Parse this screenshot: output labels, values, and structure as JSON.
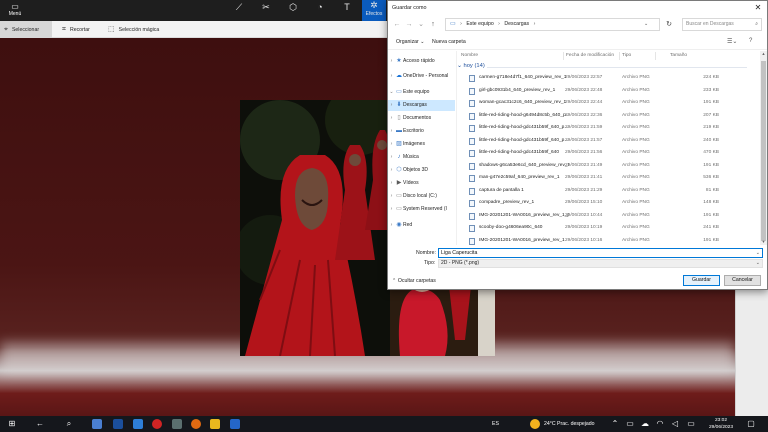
{
  "paint": {
    "menu_label": "Menú",
    "tools": [
      {
        "icon": "brush-icon",
        "glyph": "⟋"
      },
      {
        "icon": "shapes-2d-icon",
        "glyph": "✂"
      },
      {
        "icon": "shapes-3d-icon",
        "glyph": "⬡"
      },
      {
        "icon": "stickers-icon",
        "glyph": "◔"
      },
      {
        "icon": "text-icon",
        "glyph": "T"
      },
      {
        "icon": "effects-icon",
        "glyph": "✲",
        "label": "Efectos",
        "active": true
      }
    ],
    "subtools": {
      "select": "Seleccionar",
      "crop": "Recortar",
      "magic_select": "Selección mágica"
    }
  },
  "dialog": {
    "title": "Guardar como",
    "path": [
      "Este equipo",
      "Descargas"
    ],
    "search_placeholder": "Buscar en Descargas",
    "organize": "Organizar",
    "new_folder": "Nueva carpeta",
    "tree": [
      {
        "label": "Acceso rápido",
        "icon": "star-icon",
        "glyph": "★",
        "color": "#3a79c6",
        "chev": "›"
      },
      {
        "label": "OneDrive - Personal",
        "icon": "cloud-icon",
        "glyph": "☁",
        "color": "#1b74d6",
        "chev": "›"
      },
      {
        "label": "Este equipo",
        "icon": "computer-icon",
        "glyph": "▭",
        "color": "#3a79c6",
        "chev": "⌄"
      },
      {
        "label": "Descargas",
        "icon": "download-icon",
        "glyph": "⬇",
        "color": "#2f6fc0",
        "chev": "›",
        "selected": true
      },
      {
        "label": "Documentos",
        "icon": "document-icon",
        "glyph": "▯",
        "color": "#8a8a8a",
        "chev": "›"
      },
      {
        "label": "Escritorio",
        "icon": "desktop-icon",
        "glyph": "▬",
        "color": "#3a79c6",
        "chev": "›"
      },
      {
        "label": "Imágenes",
        "icon": "pictures-icon",
        "glyph": "▨",
        "color": "#3a79c6",
        "chev": "›"
      },
      {
        "label": "Música",
        "icon": "music-icon",
        "glyph": "♪",
        "color": "#3a79c6",
        "chev": "›"
      },
      {
        "label": "Objetos 3D",
        "icon": "cube-icon",
        "glyph": "⬡",
        "color": "#3a79c6",
        "chev": "›"
      },
      {
        "label": "Vídeos",
        "icon": "video-icon",
        "glyph": "▶",
        "color": "#5a5a5a",
        "chev": "›"
      },
      {
        "label": "Disco local (C:)",
        "icon": "drive-icon",
        "glyph": "▭",
        "color": "#7a7a7a",
        "chev": "›"
      },
      {
        "label": "System Reserved (I",
        "icon": "drive-icon",
        "glyph": "▭",
        "color": "#7a7a7a",
        "chev": "›"
      },
      {
        "label": "Red",
        "icon": "network-icon",
        "glyph": "◉",
        "color": "#3a79c6",
        "chev": "›"
      }
    ],
    "columns": {
      "name": "Nombre",
      "date": "Fecha de modificación",
      "type": "Tipo",
      "size": "Tamaño"
    },
    "group_label": "hoy (14)",
    "files": [
      {
        "name": "carmen-g718e4d7f1_640_preview_rev_1",
        "date": "29/06/2023 22:57",
        "type": "Archivo PNG",
        "size": "224 KB"
      },
      {
        "name": "girl-gbc0931b4_640_preview_rev_1",
        "date": "29/06/2023 22:48",
        "type": "Archivo PNG",
        "size": "233 KB"
      },
      {
        "name": "woman-gcac31c2c6_640_preview_rev_1",
        "date": "29/06/2023 22:44",
        "type": "Archivo PNG",
        "size": "191 KB"
      },
      {
        "name": "little-red-riding-hood-g6494d8c5b_640_p...",
        "date": "29/06/2023 22:36",
        "type": "Archivo PNG",
        "size": "207 KB"
      },
      {
        "name": "little-red-riding-hood-gdc431b59f_640_p...",
        "date": "29/06/2023 21:59",
        "type": "Archivo PNG",
        "size": "219 KB"
      },
      {
        "name": "little-red-riding-hood-gdc431b59f_640_p...",
        "date": "29/06/2023 21:57",
        "type": "Archivo PNG",
        "size": "240 KB"
      },
      {
        "name": "little-red-riding-hood-gdc431b59f_640",
        "date": "29/06/2023 21:56",
        "type": "Archivo PNG",
        "size": "470 KB"
      },
      {
        "name": "shadows-g6ca53e6cd_640_preview_rev_1",
        "date": "29/06/2023 21:49",
        "type": "Archivo PNG",
        "size": "191 KB"
      },
      {
        "name": "man-g47e2c59af_640_preview_rev_1",
        "date": "29/06/2023 21:41",
        "type": "Archivo PNG",
        "size": "536 KB"
      },
      {
        "name": "captura de pantalla 1",
        "date": "29/06/2023 21:29",
        "type": "Archivo PNG",
        "size": "81 KB"
      },
      {
        "name": "compadre_preview_rev_1",
        "date": "29/06/2023 15:10",
        "type": "Archivo PNG",
        "size": "148 KB"
      },
      {
        "name": "IMG-20201201-WA0016_preview_rev_1_pr...",
        "date": "29/06/2023 10:44",
        "type": "Archivo PNG",
        "size": "191 KB"
      },
      {
        "name": "scooby-doo-g4606ea90c_640",
        "date": "29/06/2023 10:19",
        "type": "Archivo PNG",
        "size": "241 KB"
      },
      {
        "name": "IMG-20201201-WA0016_preview_rev_1",
        "date": "29/06/2023 10:16",
        "type": "Archivo PNG",
        "size": "191 KB"
      }
    ],
    "name_label": "Nombre:",
    "name_value": "Liga Caperucita",
    "type_label": "Tipo:",
    "type_value": "2D - PNG (*.png)",
    "hide_folders": "Ocultar carpetas",
    "save": "Guardar",
    "cancel": "Cancelar"
  },
  "taskbar": {
    "language": "ES",
    "weather": "24°C  Prac. despejado",
    "time": "23:02",
    "date": "29/06/2023"
  }
}
